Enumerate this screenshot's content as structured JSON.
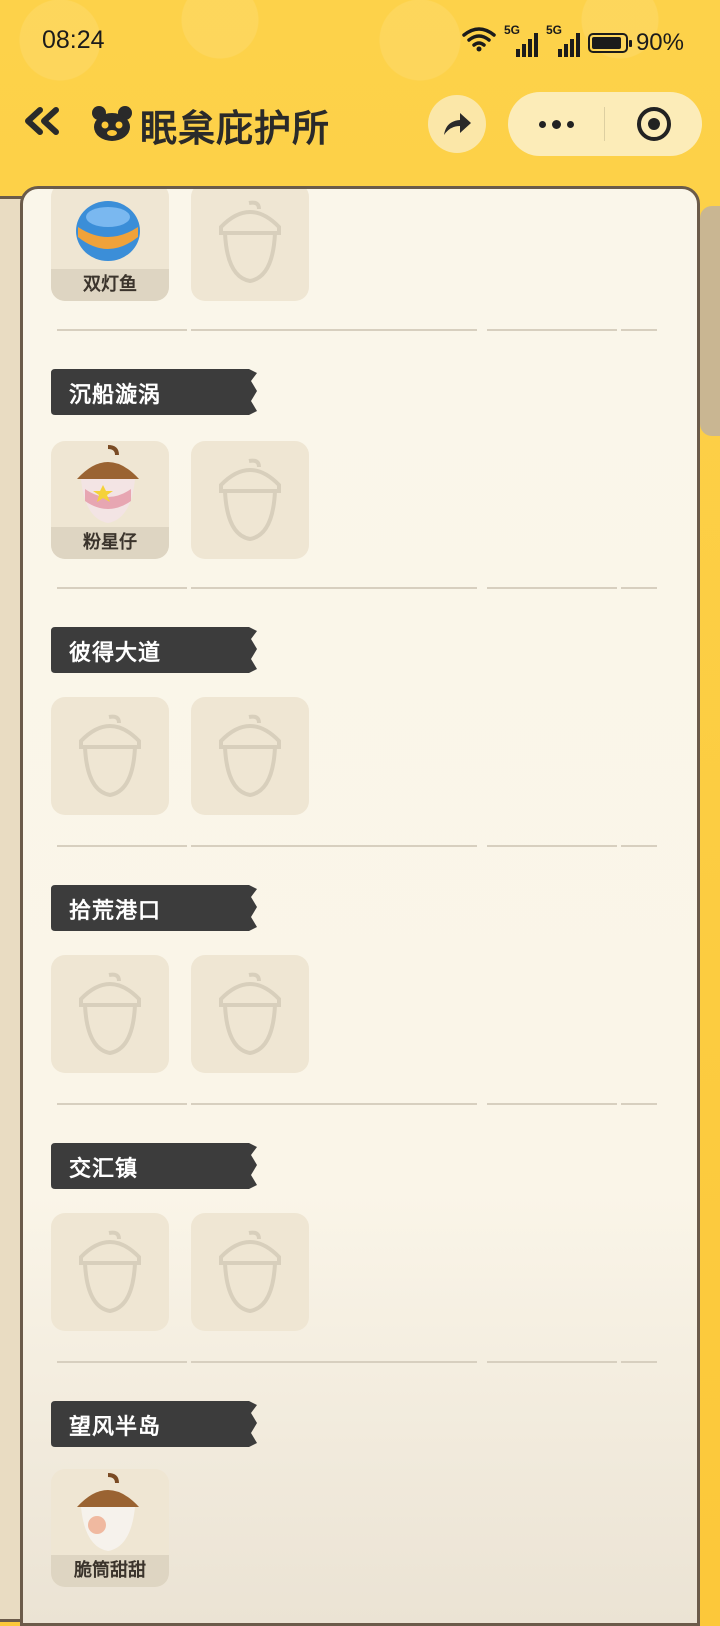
{
  "status_bar": {
    "time": "08:24",
    "battery": "90%",
    "battery_level": 0.9,
    "signal_labels": [
      "5G",
      "5G"
    ]
  },
  "nav": {
    "title": "眠枲庇护所"
  },
  "sections": [
    {
      "title": "",
      "slots": [
        {
          "filled": true,
          "name": "双灯鱼"
        },
        {
          "filled": false
        }
      ]
    },
    {
      "title": "沉船漩涡",
      "slots": [
        {
          "filled": true,
          "name": "粉星仔"
        },
        {
          "filled": false
        }
      ]
    },
    {
      "title": "彼得大道",
      "slots": [
        {
          "filled": false
        },
        {
          "filled": false
        }
      ]
    },
    {
      "title": "拾荒港口",
      "slots": [
        {
          "filled": false
        },
        {
          "filled": false
        }
      ]
    },
    {
      "title": "交汇镇",
      "slots": [
        {
          "filled": false
        },
        {
          "filled": false
        }
      ]
    },
    {
      "title": "望风半岛",
      "slots": [
        {
          "filled": true,
          "name": "脆筒甜甜"
        }
      ]
    }
  ],
  "colors": {
    "background": "#fcc83a",
    "tag": "#3c3c3c",
    "card": "#faf6ea"
  }
}
